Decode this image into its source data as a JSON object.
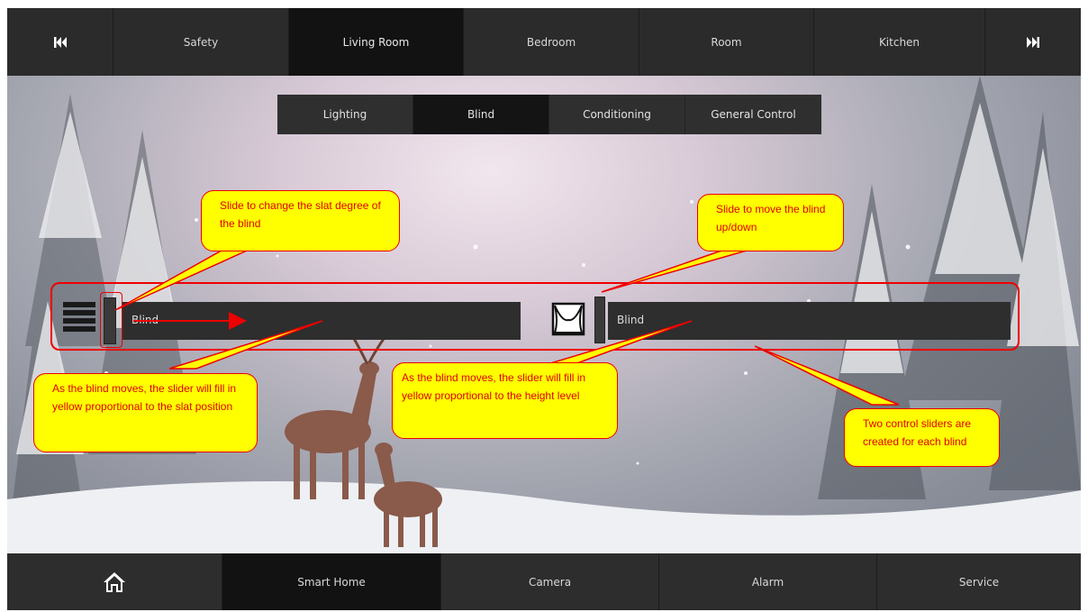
{
  "topnav": {
    "prev_icon": "skip-back-icon",
    "next_icon": "skip-forward-icon",
    "items": [
      "Safety",
      "Living Room",
      "Bedroom",
      "Room",
      "Kitchen"
    ],
    "active": "Living Room"
  },
  "subtabs": {
    "items": [
      "Lighting",
      "Blind",
      "Conditioning",
      "General Control"
    ],
    "active": "Blind"
  },
  "sliders": {
    "slat": {
      "label": "Blind",
      "icon": "blind-slats-icon",
      "fill": 0
    },
    "height": {
      "label": "Blind",
      "icon": "curtain-window-icon",
      "fill": 0
    }
  },
  "callouts": {
    "slat_top": "Slide to change the slat degree of the blind",
    "height_top": "Slide to move the blind up/down",
    "slat_bottom": "As the blind moves, the slider will fill in yellow proportional to the slat position",
    "height_bottom": "As the blind moves, the slider will fill in yellow proportional to the height level",
    "right_bottom": "Two control sliders are created for each blind"
  },
  "colors": {
    "annotation_red": "#e00000",
    "callout_yellow": "#ffff00",
    "bar_dark": "#2b2b2b"
  },
  "botnav": {
    "home_icon": "home-icon",
    "items": [
      "Smart Home",
      "Camera",
      "Alarm",
      "Service"
    ],
    "active": "Smart Home"
  }
}
